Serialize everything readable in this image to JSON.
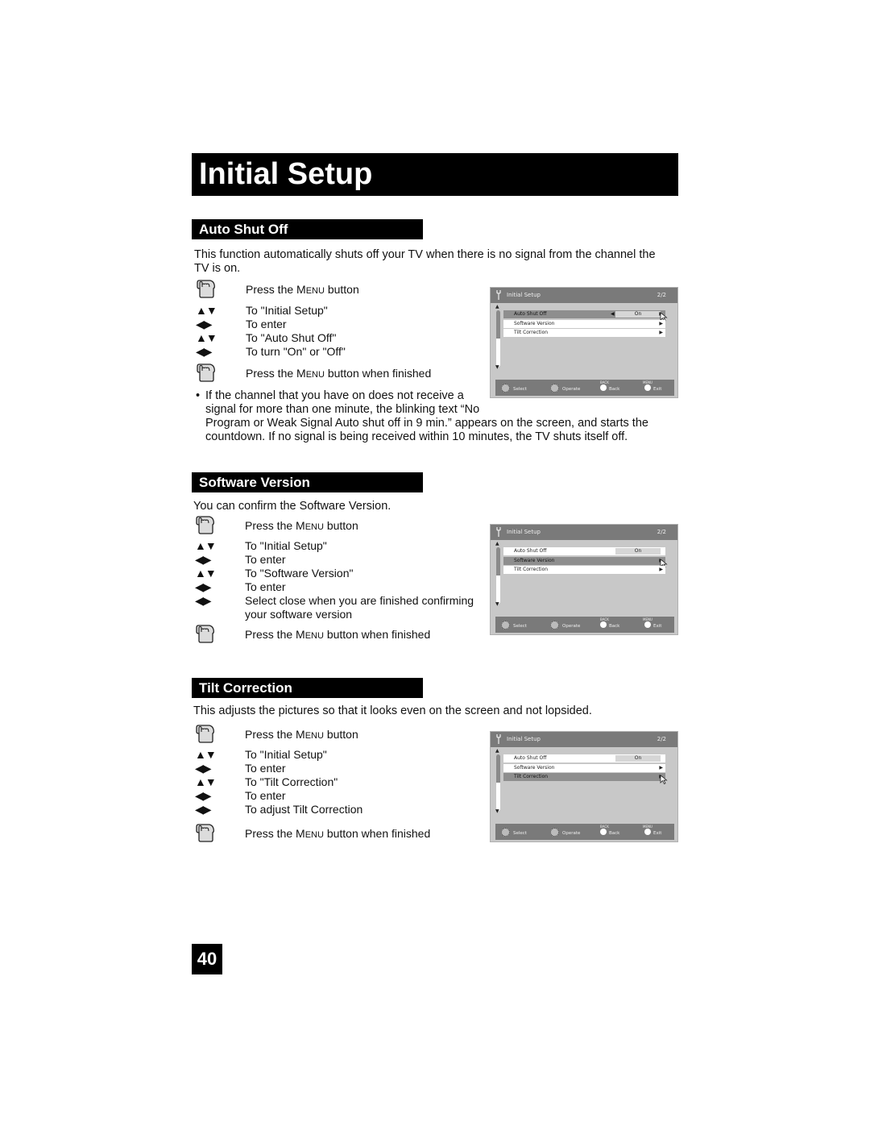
{
  "page_title": "Initial Setup",
  "page_number": "40",
  "sections": {
    "auto_shut_off": {
      "title": "Auto Shut Off",
      "intro_line1": "This function automatically shuts off your TV when there is no signal from the channel the",
      "intro_line2": "TV is on.",
      "steps": [
        {
          "icon": "hand",
          "text_pre": "Press the M",
          "text_sc": "ENU",
          "text_post": " button"
        },
        {
          "icon": "up-down",
          "symbol": "▲▼",
          "text": "To \"Initial Setup\""
        },
        {
          "icon": "left-right",
          "symbol": "◀▶",
          "text": "To enter"
        },
        {
          "icon": "up-down",
          "symbol": "▲▼",
          "text": "To \"Auto Shut Off\""
        },
        {
          "icon": "left-right",
          "symbol": "◀▶",
          "text": "To turn \"On\" or \"Off\""
        },
        {
          "icon": "hand",
          "text_pre": "Press the M",
          "text_sc": "ENU",
          "text_post": " button when finished"
        }
      ],
      "bullet": "•",
      "note_line1": "If the channel that you have on does not receive a",
      "note_line2": "signal for more than one minute, the blinking text “No",
      "note_line3": "Program or Weak Signal Auto shut off in 9 min.” appears on the screen, and starts the",
      "note_line4": "countdown. If no signal is being received within 10 minutes, the TV shuts itself off."
    },
    "software_version": {
      "title": "Software Version",
      "intro": "You can confirm the Software Version.",
      "steps": [
        {
          "icon": "hand",
          "text_pre": "Press the M",
          "text_sc": "ENU",
          "text_post": " button"
        },
        {
          "icon": "up-down",
          "symbol": "▲▼",
          "text": "To \"Initial Setup\""
        },
        {
          "icon": "left-right",
          "symbol": "◀▶",
          "text": "To enter"
        },
        {
          "icon": "up-down",
          "symbol": "▲▼",
          "text": "To \"Software Version\""
        },
        {
          "icon": "left-right",
          "symbol": "◀▶",
          "text": "To enter"
        },
        {
          "icon": "left-right",
          "symbol": "◀▶",
          "text": "Select close when you are finished confirming",
          "text2": "your software version"
        },
        {
          "icon": "hand",
          "text_pre": "Press the M",
          "text_sc": "ENU",
          "text_post": " button when finished"
        }
      ]
    },
    "tilt_correction": {
      "title": "Tilt Correction",
      "intro": "This adjusts the pictures so that it looks even on the screen and not lopsided.",
      "steps": [
        {
          "icon": "hand",
          "text_pre": "Press the M",
          "text_sc": "ENU",
          "text_post": " button"
        },
        {
          "icon": "up-down",
          "symbol": "▲▼",
          "text": "To \"Initial Setup\""
        },
        {
          "icon": "left-right",
          "symbol": "◀▶",
          "text": "To enter"
        },
        {
          "icon": "up-down",
          "symbol": "▲▼",
          "text": "To \"Tilt Correction\""
        },
        {
          "icon": "left-right",
          "symbol": "◀▶",
          "text": "To enter"
        },
        {
          "icon": "left-right",
          "symbol": "◀▶",
          "text": "To adjust Tilt Correction"
        },
        {
          "icon": "hand",
          "text_pre": "Press the M",
          "text_sc": "ENU",
          "text_post": " button when finished"
        }
      ]
    }
  },
  "tv_menu": {
    "title": "Initial Setup",
    "page": "2/2",
    "items": [
      "Auto Shut Off",
      "Software Version",
      "Tilt Correction"
    ],
    "auto_shut_off_value": "On",
    "footer": {
      "select": "Select",
      "operate": "Operate",
      "back_tag": "BACK",
      "back": "Back",
      "menu_tag": "MENU",
      "exit": "Exit"
    },
    "screens": [
      {
        "selected": "Auto Shut Off"
      },
      {
        "selected": "Software Version"
      },
      {
        "selected": "Tilt Correction"
      }
    ]
  },
  "colors": {
    "title_bar": "#000000",
    "tv_bg": "#c8c8c8",
    "tv_header": "#7a7a7a",
    "tv_selected_row": "#8e8e8e"
  }
}
